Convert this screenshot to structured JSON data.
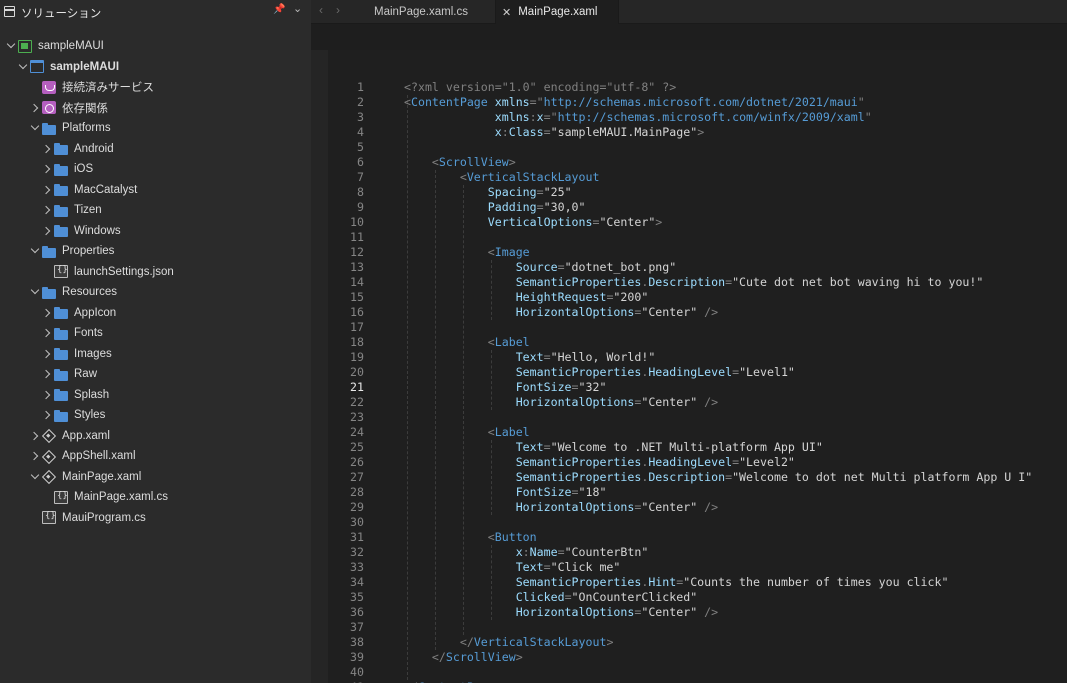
{
  "solution_pad": {
    "title": "ソリューション",
    "items": [
      {
        "label": "sampleMAUI",
        "icon": "solution-icon",
        "indent": 0,
        "expander": "down",
        "bold": false
      },
      {
        "label": "sampleMAUI",
        "icon": "project-icon",
        "indent": 1,
        "expander": "down",
        "bold": true
      },
      {
        "label": "接続済みサービス",
        "icon": "connected-services-icon",
        "indent": 2,
        "expander": "none",
        "bold": false
      },
      {
        "label": "依存関係",
        "icon": "dependencies-icon",
        "indent": 2,
        "expander": "right",
        "bold": false
      },
      {
        "label": "Platforms",
        "icon": "folder-icon",
        "indent": 2,
        "expander": "down",
        "bold": false
      },
      {
        "label": "Android",
        "icon": "folder-icon",
        "indent": 3,
        "expander": "right",
        "bold": false
      },
      {
        "label": "iOS",
        "icon": "folder-icon",
        "indent": 3,
        "expander": "right",
        "bold": false
      },
      {
        "label": "MacCatalyst",
        "icon": "folder-icon",
        "indent": 3,
        "expander": "right",
        "bold": false
      },
      {
        "label": "Tizen",
        "icon": "folder-icon",
        "indent": 3,
        "expander": "right",
        "bold": false
      },
      {
        "label": "Windows",
        "icon": "folder-icon",
        "indent": 3,
        "expander": "right",
        "bold": false
      },
      {
        "label": "Properties",
        "icon": "folder-icon",
        "indent": 2,
        "expander": "down",
        "bold": false
      },
      {
        "label": "launchSettings.json",
        "icon": "json-file-icon",
        "indent": 3,
        "expander": "none",
        "bold": false
      },
      {
        "label": "Resources",
        "icon": "folder-icon",
        "indent": 2,
        "expander": "down",
        "bold": false
      },
      {
        "label": "AppIcon",
        "icon": "folder-icon",
        "indent": 3,
        "expander": "right",
        "bold": false
      },
      {
        "label": "Fonts",
        "icon": "folder-icon",
        "indent": 3,
        "expander": "right",
        "bold": false
      },
      {
        "label": "Images",
        "icon": "folder-icon",
        "indent": 3,
        "expander": "right",
        "bold": false
      },
      {
        "label": "Raw",
        "icon": "folder-icon",
        "indent": 3,
        "expander": "right",
        "bold": false
      },
      {
        "label": "Splash",
        "icon": "folder-icon",
        "indent": 3,
        "expander": "right",
        "bold": false
      },
      {
        "label": "Styles",
        "icon": "folder-icon",
        "indent": 3,
        "expander": "right",
        "bold": false
      },
      {
        "label": "App.xaml",
        "icon": "xaml-file-icon",
        "indent": 2,
        "expander": "right",
        "bold": false
      },
      {
        "label": "AppShell.xaml",
        "icon": "xaml-file-icon",
        "indent": 2,
        "expander": "right",
        "bold": false
      },
      {
        "label": "MainPage.xaml",
        "icon": "xaml-file-icon",
        "indent": 2,
        "expander": "down",
        "bold": false
      },
      {
        "label": "MainPage.xaml.cs",
        "icon": "cs-file-icon",
        "indent": 3,
        "expander": "none",
        "bold": false
      },
      {
        "label": "MauiProgram.cs",
        "icon": "cs-file-icon",
        "indent": 2,
        "expander": "none",
        "bold": false
      }
    ]
  },
  "tabs": [
    {
      "label": "MainPage.xaml.cs",
      "active": false
    },
    {
      "label": "MainPage.xaml",
      "active": true
    }
  ],
  "editor": {
    "current_line": 21,
    "lines": [
      [
        [
          "p",
          "<?xml version=\"1.0\" encoding=\"utf-8\" ?>"
        ]
      ],
      [
        [
          "p",
          "<"
        ],
        [
          "t",
          "ContentPage"
        ],
        [
          "s",
          " "
        ],
        [
          "a",
          "xmlns"
        ],
        [
          "p",
          "=\""
        ],
        [
          "t",
          "http://schemas.microsoft.com/dotnet/2021/maui"
        ],
        [
          "p",
          "\""
        ]
      ],
      [
        [
          "s",
          "             "
        ],
        [
          "a",
          "xmlns"
        ],
        [
          "p",
          ":"
        ],
        [
          "a",
          "x"
        ],
        [
          "p",
          "=\""
        ],
        [
          "t",
          "http://schemas.microsoft.com/winfx/2009/xaml"
        ],
        [
          "p",
          "\""
        ]
      ],
      [
        [
          "s",
          "             "
        ],
        [
          "a",
          "x"
        ],
        [
          "p",
          ":"
        ],
        [
          "a",
          "Class"
        ],
        [
          "p",
          "="
        ],
        [
          "s",
          "\"sampleMAUI.MainPage\""
        ],
        [
          "p",
          ">"
        ]
      ],
      [],
      [
        [
          "s",
          "    "
        ],
        [
          "p",
          "<"
        ],
        [
          "t",
          "ScrollView"
        ],
        [
          "p",
          ">"
        ]
      ],
      [
        [
          "s",
          "        "
        ],
        [
          "p",
          "<"
        ],
        [
          "t",
          "VerticalStackLayout"
        ]
      ],
      [
        [
          "s",
          "            "
        ],
        [
          "a",
          "Spacing"
        ],
        [
          "p",
          "="
        ],
        [
          "s",
          "\"25\""
        ]
      ],
      [
        [
          "s",
          "            "
        ],
        [
          "a",
          "Padding"
        ],
        [
          "p",
          "="
        ],
        [
          "s",
          "\"30,0\""
        ]
      ],
      [
        [
          "s",
          "            "
        ],
        [
          "a",
          "VerticalOptions"
        ],
        [
          "p",
          "="
        ],
        [
          "s",
          "\"Center\""
        ],
        [
          "p",
          ">"
        ]
      ],
      [],
      [
        [
          "s",
          "            "
        ],
        [
          "p",
          "<"
        ],
        [
          "t",
          "Image"
        ]
      ],
      [
        [
          "s",
          "                "
        ],
        [
          "a",
          "Source"
        ],
        [
          "p",
          "="
        ],
        [
          "s",
          "\"dotnet_bot.png\""
        ]
      ],
      [
        [
          "s",
          "                "
        ],
        [
          "a",
          "SemanticProperties"
        ],
        [
          "p",
          "."
        ],
        [
          "a",
          "Description"
        ],
        [
          "p",
          "="
        ],
        [
          "s",
          "\"Cute dot net bot waving hi to you!\""
        ]
      ],
      [
        [
          "s",
          "                "
        ],
        [
          "a",
          "HeightRequest"
        ],
        [
          "p",
          "="
        ],
        [
          "s",
          "\"200\""
        ]
      ],
      [
        [
          "s",
          "                "
        ],
        [
          "a",
          "HorizontalOptions"
        ],
        [
          "p",
          "="
        ],
        [
          "s",
          "\"Center\""
        ],
        [
          "s",
          " "
        ],
        [
          "p",
          "/>"
        ]
      ],
      [],
      [
        [
          "s",
          "            "
        ],
        [
          "p",
          "<"
        ],
        [
          "t",
          "Label"
        ]
      ],
      [
        [
          "s",
          "                "
        ],
        [
          "a",
          "Text"
        ],
        [
          "p",
          "="
        ],
        [
          "s",
          "\"Hello, World!\""
        ]
      ],
      [
        [
          "s",
          "                "
        ],
        [
          "a",
          "SemanticProperties"
        ],
        [
          "p",
          "."
        ],
        [
          "a",
          "HeadingLevel"
        ],
        [
          "p",
          "="
        ],
        [
          "s",
          "\"Level1\""
        ]
      ],
      [
        [
          "s",
          "                "
        ],
        [
          "a",
          "FontSize"
        ],
        [
          "p",
          "="
        ],
        [
          "s",
          "\"32\""
        ]
      ],
      [
        [
          "s",
          "                "
        ],
        [
          "a",
          "HorizontalOptions"
        ],
        [
          "p",
          "="
        ],
        [
          "s",
          "\"Center\""
        ],
        [
          "s",
          " "
        ],
        [
          "p",
          "/>"
        ]
      ],
      [],
      [
        [
          "s",
          "            "
        ],
        [
          "p",
          "<"
        ],
        [
          "t",
          "Label"
        ]
      ],
      [
        [
          "s",
          "                "
        ],
        [
          "a",
          "Text"
        ],
        [
          "p",
          "="
        ],
        [
          "s",
          "\"Welcome to .NET Multi-platform App UI\""
        ]
      ],
      [
        [
          "s",
          "                "
        ],
        [
          "a",
          "SemanticProperties"
        ],
        [
          "p",
          "."
        ],
        [
          "a",
          "HeadingLevel"
        ],
        [
          "p",
          "="
        ],
        [
          "s",
          "\"Level2\""
        ]
      ],
      [
        [
          "s",
          "                "
        ],
        [
          "a",
          "SemanticProperties"
        ],
        [
          "p",
          "."
        ],
        [
          "a",
          "Description"
        ],
        [
          "p",
          "="
        ],
        [
          "s",
          "\"Welcome to dot net Multi platform App U I\""
        ]
      ],
      [
        [
          "s",
          "                "
        ],
        [
          "a",
          "FontSize"
        ],
        [
          "p",
          "="
        ],
        [
          "s",
          "\"18\""
        ]
      ],
      [
        [
          "s",
          "                "
        ],
        [
          "a",
          "HorizontalOptions"
        ],
        [
          "p",
          "="
        ],
        [
          "s",
          "\"Center\""
        ],
        [
          "s",
          " "
        ],
        [
          "p",
          "/>"
        ]
      ],
      [],
      [
        [
          "s",
          "            "
        ],
        [
          "p",
          "<"
        ],
        [
          "t",
          "Button"
        ]
      ],
      [
        [
          "s",
          "                "
        ],
        [
          "a",
          "x"
        ],
        [
          "p",
          ":"
        ],
        [
          "a",
          "Name"
        ],
        [
          "p",
          "="
        ],
        [
          "s",
          "\"CounterBtn\""
        ]
      ],
      [
        [
          "s",
          "                "
        ],
        [
          "a",
          "Text"
        ],
        [
          "p",
          "="
        ],
        [
          "s",
          "\"Click me\""
        ]
      ],
      [
        [
          "s",
          "                "
        ],
        [
          "a",
          "SemanticProperties"
        ],
        [
          "p",
          "."
        ],
        [
          "a",
          "Hint"
        ],
        [
          "p",
          "="
        ],
        [
          "s",
          "\"Counts the number of times you click\""
        ]
      ],
      [
        [
          "s",
          "                "
        ],
        [
          "a",
          "Clicked"
        ],
        [
          "p",
          "="
        ],
        [
          "s",
          "\"OnCounterClicked\""
        ]
      ],
      [
        [
          "s",
          "                "
        ],
        [
          "a",
          "HorizontalOptions"
        ],
        [
          "p",
          "="
        ],
        [
          "s",
          "\"Center\""
        ],
        [
          "s",
          " "
        ],
        [
          "p",
          "/>"
        ]
      ],
      [],
      [
        [
          "s",
          "        "
        ],
        [
          "p",
          "</"
        ],
        [
          "t",
          "VerticalStackLayout"
        ],
        [
          "p",
          ">"
        ]
      ],
      [
        [
          "s",
          "    "
        ],
        [
          "p",
          "</"
        ],
        [
          "t",
          "ScrollView"
        ],
        [
          "p",
          ">"
        ]
      ],
      [],
      [
        [
          "p",
          "</"
        ],
        [
          "t",
          "ContentPage"
        ],
        [
          "p",
          ">"
        ]
      ],
      []
    ]
  }
}
